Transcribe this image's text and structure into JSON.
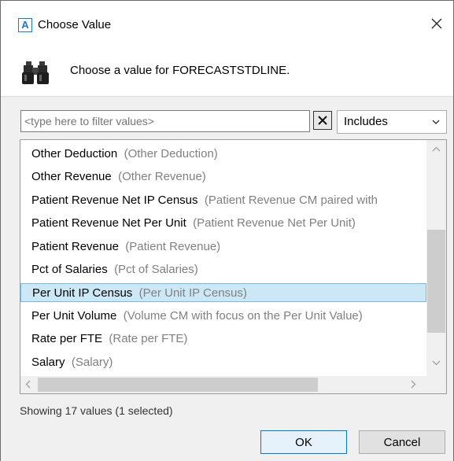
{
  "window": {
    "app_icon_letter": "A",
    "title": "Choose Value",
    "close_icon": "close-icon"
  },
  "header": {
    "icon": "binoculars-icon",
    "prompt": "Choose a value for FORECASTSTDLINE."
  },
  "filter": {
    "placeholder": "<type here to filter values>",
    "value": "",
    "clear_icon": "clear-filter-icon",
    "mode": "Includes"
  },
  "list": {
    "items": [
      {
        "name": "Other Deduction",
        "desc": "(Other Deduction)",
        "selected": false
      },
      {
        "name": "Other Revenue",
        "desc": "(Other Revenue)",
        "selected": false
      },
      {
        "name": "Patient Revenue Net IP Census",
        "desc": "(Patient Revenue CM paired with",
        "selected": false
      },
      {
        "name": "Patient Revenue Net Per Unit",
        "desc": "(Patient Revenue Net Per Unit)",
        "selected": false
      },
      {
        "name": "Patient Revenue",
        "desc": "(Patient Revenue)",
        "selected": false
      },
      {
        "name": "Pct of Salaries",
        "desc": "(Pct of Salaries)",
        "selected": false
      },
      {
        "name": "Per Unit IP Census",
        "desc": "(Per Unit IP Census)",
        "selected": true
      },
      {
        "name": "Per Unit Volume",
        "desc": "(Volume CM with focus on the Per Unit Value)",
        "selected": false
      },
      {
        "name": "Rate per FTE",
        "desc": "(Rate per FTE)",
        "selected": false
      },
      {
        "name": "Salary",
        "desc": "(Salary)",
        "selected": false
      }
    ]
  },
  "status": "Showing 17 values (1 selected)",
  "buttons": {
    "ok": "OK",
    "cancel": "Cancel"
  },
  "colors": {
    "accent": "#0078d7",
    "selection_bg": "#cce8f6",
    "desc_text": "#808080"
  }
}
